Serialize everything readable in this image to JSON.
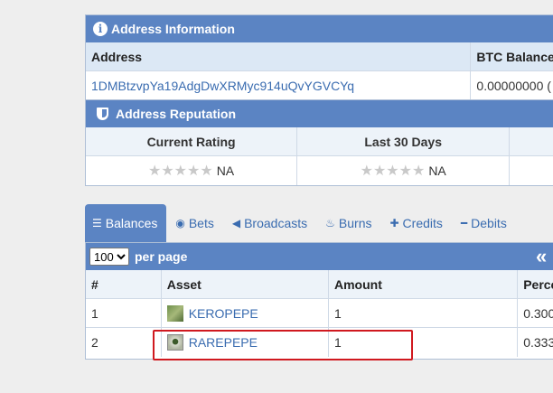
{
  "address_panel": {
    "title": "Address Information",
    "col_address": "Address",
    "col_btc": "BTC Balance",
    "address": "1DMBtzvpYa19AdgDwXRMyc914uQvYGVCYq",
    "btc_balance": "0.00000000 ("
  },
  "reputation_panel": {
    "title": "Address Reputation",
    "col_current": "Current Rating",
    "col_last30": "Last 30 Days",
    "current_value": "NA",
    "last30_value": "NA"
  },
  "tabs": [
    {
      "label": "Balances",
      "icon": "list-icon",
      "glyph": "☰",
      "active": true
    },
    {
      "label": "Bets",
      "icon": "target-icon",
      "glyph": "◉"
    },
    {
      "label": "Broadcasts",
      "icon": "bullhorn-icon",
      "glyph": "📢"
    },
    {
      "label": "Burns",
      "icon": "flame-icon",
      "glyph": "🔥"
    },
    {
      "label": "Credits",
      "icon": "plus-icon",
      "glyph": "✚"
    },
    {
      "label": "Debits",
      "icon": "minus-icon",
      "glyph": "▬"
    }
  ],
  "balances": {
    "page_size": "100",
    "per_page_label": "per page",
    "nav_glyph": "«",
    "col_num": "#",
    "col_asset": "Asset",
    "col_amount": "Amount",
    "col_percent": "Perce",
    "rows": [
      {
        "num": "1",
        "asset": "KEROPEPE",
        "amount": "1",
        "percent": "0.300"
      },
      {
        "num": "2",
        "asset": "RAREPEPE",
        "amount": "1",
        "percent": "0.333"
      }
    ]
  },
  "colors": {
    "header": "#5b84c3",
    "link": "#3a6cb0",
    "highlight": "#d0191f"
  }
}
